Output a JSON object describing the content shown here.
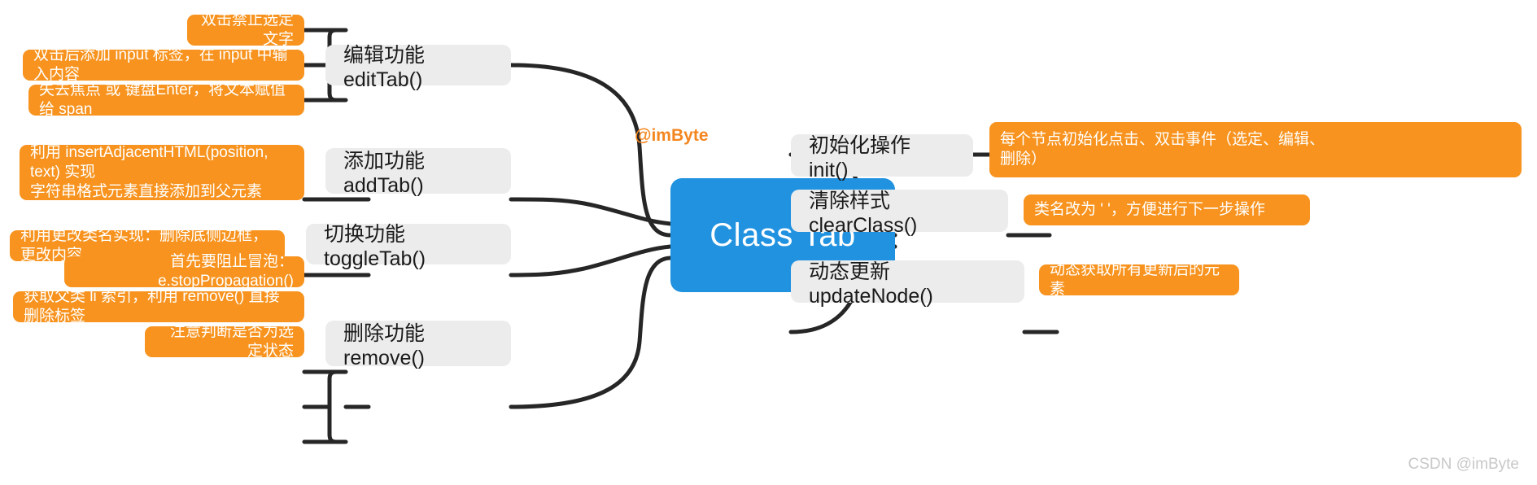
{
  "root": {
    "label": "Class Tab",
    "color": "#2192e0"
  },
  "byline": {
    "label": "@imByte",
    "color": "#f4861f"
  },
  "watermark": {
    "label": "CSDN @imByte"
  },
  "palette": {
    "leaf": "#f7931e",
    "branch": "#ececec",
    "link": "#262626"
  },
  "left_branches": [
    {
      "label": "编辑功能 editTab()",
      "leaves": [
        "双击禁止选定文字",
        "双击后添加 input 标签，在 input 中输入内容",
        "失去焦点 或 键盘Enter，将文本赋值给 span"
      ]
    },
    {
      "label": "添加功能 addTab()",
      "leaves": [
        "利用 insertAdjacentHTML(position, text) 实现\n字符串格式元素直接添加到父元素"
      ]
    },
    {
      "label": "切换功能 toggleTab()",
      "leaves": [
        "利用更改类名实现：删除底侧边框，更改内容"
      ]
    },
    {
      "label": "删除功能 remove()",
      "leaves": [
        "首先要阻止冒泡：e.stopPropagation()",
        "获取父类 li 索引，利用 remove() 直接删除标签",
        "注意判断是否为选定状态"
      ]
    }
  ],
  "right_branches": [
    {
      "label": "初始化操作 init()",
      "leaves": [
        "每个节点初始化点击、双击事件（选定、编辑、\n删除）"
      ]
    },
    {
      "label": "清除样式 clearClass()",
      "leaves": [
        "类名改为 ' '，方便进行下一步操作"
      ]
    },
    {
      "label": "动态更新 updateNode()",
      "leaves": [
        "动态获取所有更新后的元素"
      ]
    }
  ]
}
